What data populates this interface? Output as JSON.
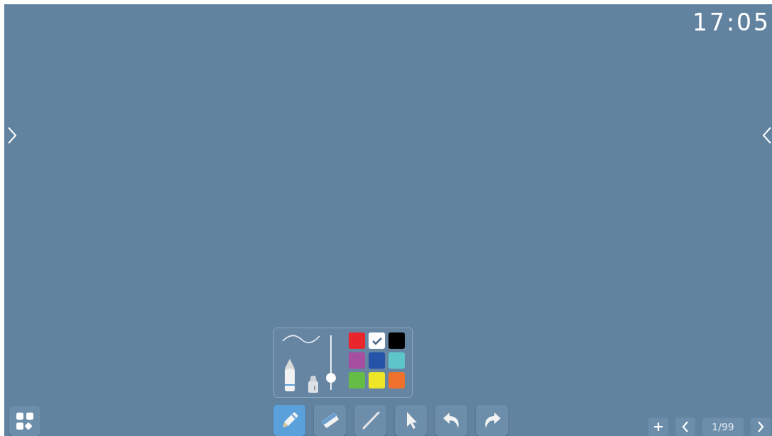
{
  "clock": "17:05",
  "pen_panel": {
    "pen_types": [
      {
        "kind": "pencil",
        "selected": true
      },
      {
        "kind": "highlighter",
        "selected": false
      }
    ],
    "thickness": {
      "level": 0.22
    },
    "colors": [
      {
        "color": "#e8262b",
        "selected": false
      },
      {
        "color": "#ffffff",
        "selected": true
      },
      {
        "color": "#000000",
        "selected": false
      },
      {
        "color": "#a64fa1",
        "selected": false
      },
      {
        "color": "#2553a8",
        "selected": false
      },
      {
        "color": "#5ec6cb",
        "selected": false
      },
      {
        "color": "#65bd45",
        "selected": false
      },
      {
        "color": "#eee627",
        "selected": false
      },
      {
        "color": "#ef712b",
        "selected": false
      }
    ]
  },
  "tools": [
    {
      "kind": "pen",
      "selected": true
    },
    {
      "kind": "eraser",
      "selected": false
    },
    {
      "kind": "line",
      "selected": false
    },
    {
      "kind": "select",
      "selected": false
    },
    {
      "kind": "undo",
      "selected": false
    },
    {
      "kind": "redo",
      "selected": false
    }
  ],
  "pager": {
    "page": "1/99"
  }
}
